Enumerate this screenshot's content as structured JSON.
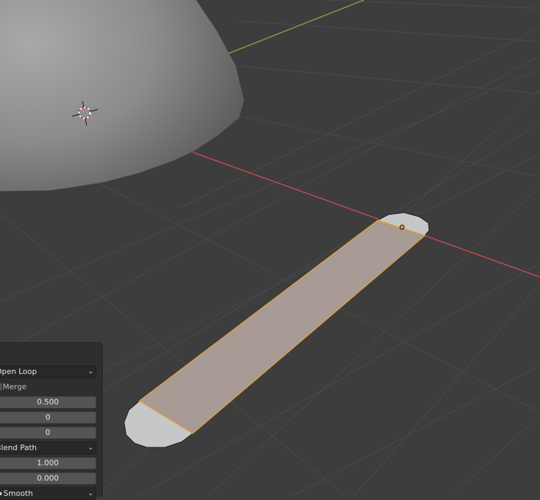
{
  "operator_panel": {
    "loop_type": "Open Loop",
    "merge_label": "Merge",
    "number_of_cuts": "0.500",
    "field_2": "0",
    "field_3": "0",
    "interpolation": "Blend Path",
    "field_5": "1.000",
    "field_6": "0.000",
    "profile_shape": "Smooth"
  },
  "icons": {
    "dropdown": "chevron-down-icon",
    "cursor": "3d-cursor-icon",
    "vertex": "selected-vertex-icon"
  },
  "colors": {
    "viewport_bg": "#3d3d3d",
    "grid": "#4a4a4a",
    "x_axis": "#c84a55",
    "y_axis": "#7ba33d",
    "selection": "#f0a030",
    "face_selected": "#a89a94",
    "panel_bg": "#2e2e2e"
  }
}
